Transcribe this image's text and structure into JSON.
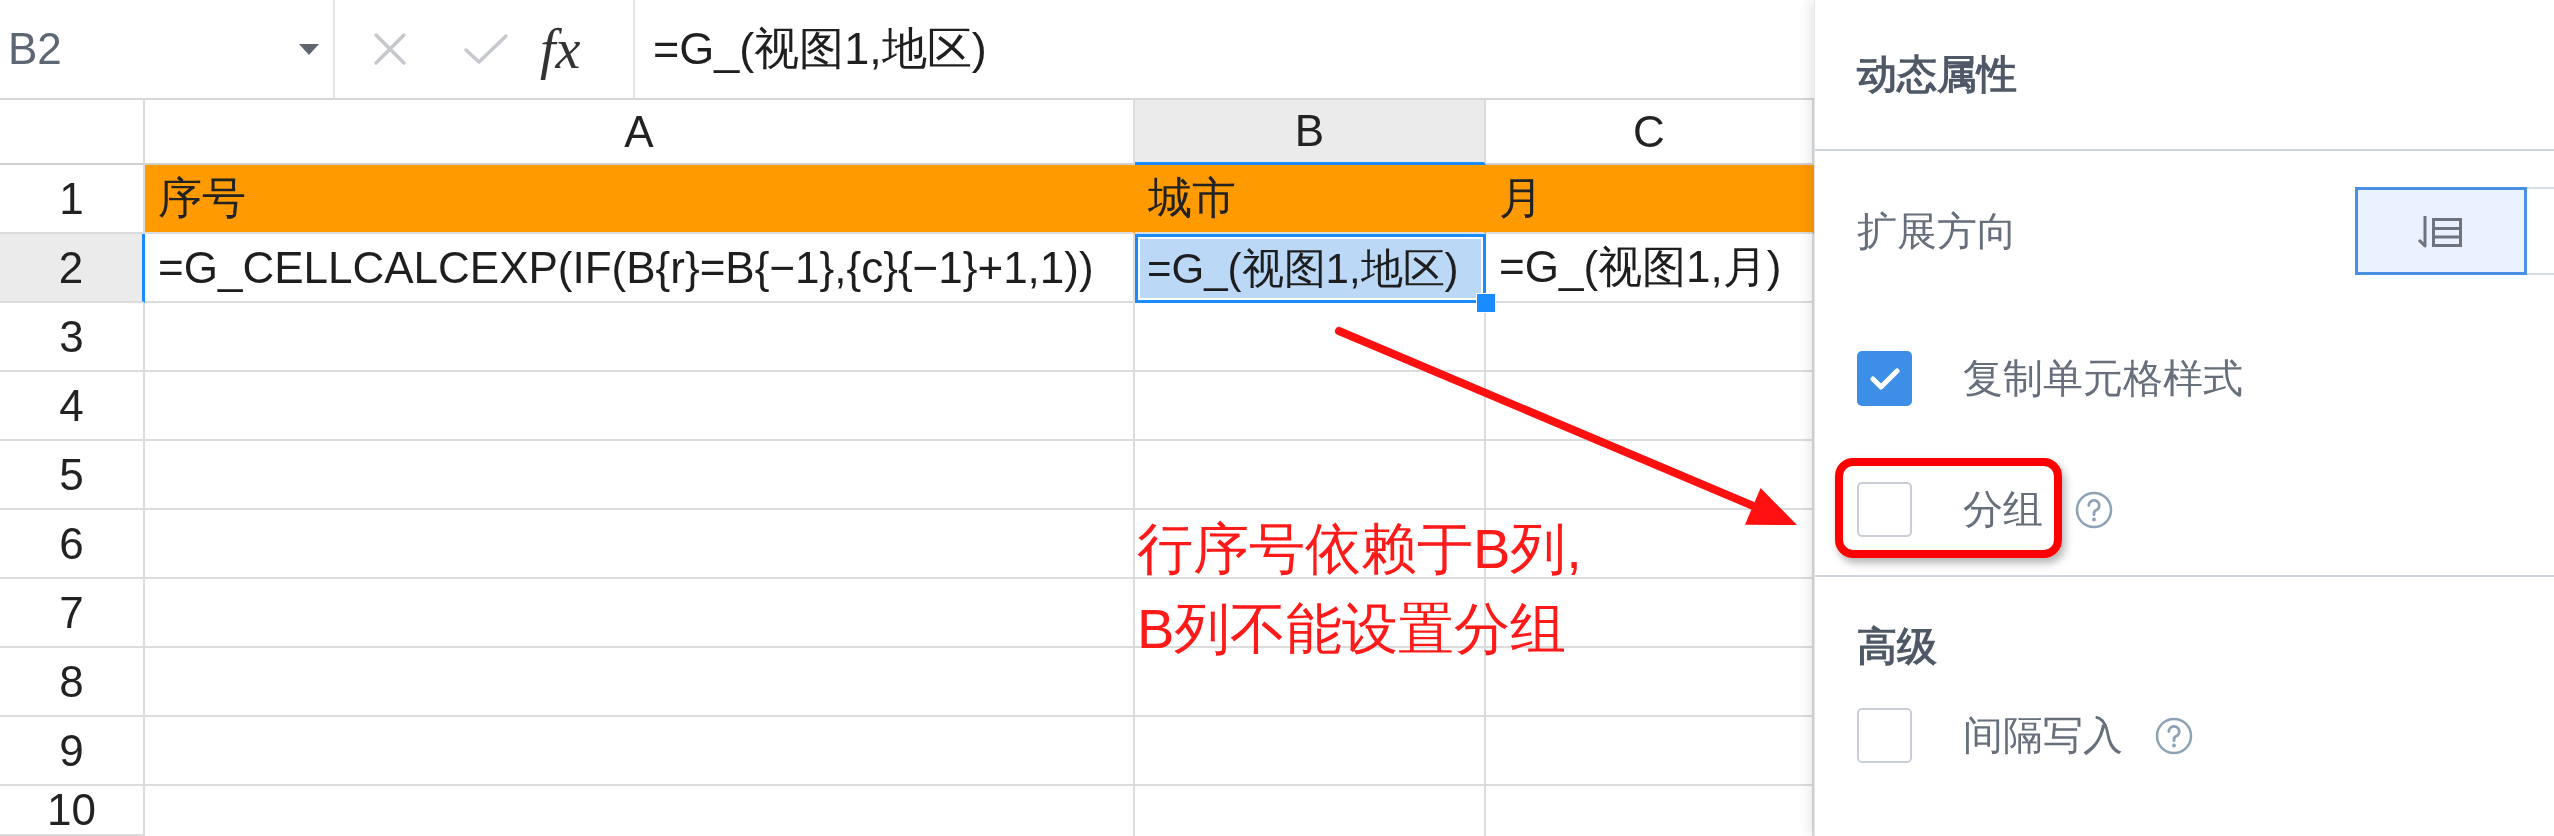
{
  "formula_bar": {
    "cell_reference": "B2",
    "function_label": "fx",
    "formula": "=G_(视图1,地区)"
  },
  "sheet": {
    "columns": [
      {
        "label": "A",
        "selected": false
      },
      {
        "label": "B",
        "selected": true
      },
      {
        "label": "C",
        "selected": false
      }
    ],
    "rows": [
      {
        "label": "1",
        "kind": "header",
        "selected": false,
        "cells": [
          {
            "text": "序号",
            "selected": false
          },
          {
            "text": "城市",
            "selected": false
          },
          {
            "text": "月",
            "selected": false
          }
        ]
      },
      {
        "label": "2",
        "kind": "data",
        "selected": true,
        "cells": [
          {
            "text": "=G_CELLCALCEXP(IF(B{r}=B{−1},{c}{−1}+1,1))",
            "selected": false
          },
          {
            "text": "=G_(视图1,地区)",
            "selected": true
          },
          {
            "text": "=G_(视图1,月)",
            "selected": false
          }
        ]
      },
      {
        "label": "3",
        "kind": "data",
        "selected": false
      },
      {
        "label": "4",
        "kind": "data",
        "selected": false
      },
      {
        "label": "5",
        "kind": "data",
        "selected": false
      },
      {
        "label": "6",
        "kind": "data",
        "selected": false
      },
      {
        "label": "7",
        "kind": "data",
        "selected": false
      },
      {
        "label": "8",
        "kind": "data",
        "selected": false
      },
      {
        "label": "9",
        "kind": "data",
        "selected": false
      },
      {
        "label": "10",
        "kind": "data",
        "selected": false
      }
    ]
  },
  "annotation": {
    "note": [
      "行序号依赖于B列,",
      "B列不能设置分组"
    ]
  },
  "panel": {
    "title": "动态属性",
    "settings": [
      {
        "kind": "segmented",
        "label": "扩展方向",
        "options": [
          {
            "selected": true
          },
          {
            "selected": false
          }
        ]
      },
      {
        "kind": "checkbox",
        "label": "复制单元格样式",
        "checked": true,
        "highlighted": false,
        "help": false
      },
      {
        "kind": "checkbox",
        "label": "分组",
        "checked": false,
        "highlighted": true,
        "help": true
      }
    ],
    "sections": [
      {
        "title": "高级",
        "settings": [
          {
            "kind": "checkbox",
            "label": "间隔写入",
            "checked": false,
            "highlighted": false,
            "help": true
          }
        ]
      }
    ]
  }
}
